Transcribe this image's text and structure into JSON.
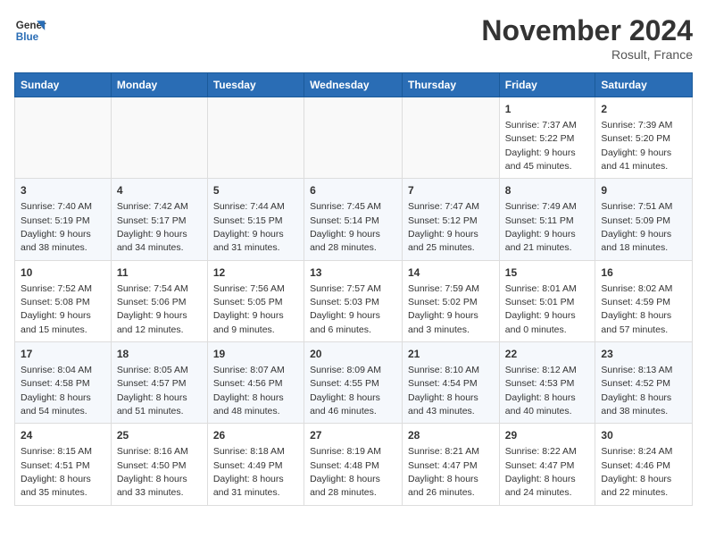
{
  "logo": {
    "line1": "General",
    "line2": "Blue"
  },
  "title": "November 2024",
  "location": "Rosult, France",
  "days_of_week": [
    "Sunday",
    "Monday",
    "Tuesday",
    "Wednesday",
    "Thursday",
    "Friday",
    "Saturday"
  ],
  "weeks": [
    [
      {
        "day": "",
        "detail": ""
      },
      {
        "day": "",
        "detail": ""
      },
      {
        "day": "",
        "detail": ""
      },
      {
        "day": "",
        "detail": ""
      },
      {
        "day": "",
        "detail": ""
      },
      {
        "day": "1",
        "detail": "Sunrise: 7:37 AM\nSunset: 5:22 PM\nDaylight: 9 hours and 45 minutes."
      },
      {
        "day": "2",
        "detail": "Sunrise: 7:39 AM\nSunset: 5:20 PM\nDaylight: 9 hours and 41 minutes."
      }
    ],
    [
      {
        "day": "3",
        "detail": "Sunrise: 7:40 AM\nSunset: 5:19 PM\nDaylight: 9 hours and 38 minutes."
      },
      {
        "day": "4",
        "detail": "Sunrise: 7:42 AM\nSunset: 5:17 PM\nDaylight: 9 hours and 34 minutes."
      },
      {
        "day": "5",
        "detail": "Sunrise: 7:44 AM\nSunset: 5:15 PM\nDaylight: 9 hours and 31 minutes."
      },
      {
        "day": "6",
        "detail": "Sunrise: 7:45 AM\nSunset: 5:14 PM\nDaylight: 9 hours and 28 minutes."
      },
      {
        "day": "7",
        "detail": "Sunrise: 7:47 AM\nSunset: 5:12 PM\nDaylight: 9 hours and 25 minutes."
      },
      {
        "day": "8",
        "detail": "Sunrise: 7:49 AM\nSunset: 5:11 PM\nDaylight: 9 hours and 21 minutes."
      },
      {
        "day": "9",
        "detail": "Sunrise: 7:51 AM\nSunset: 5:09 PM\nDaylight: 9 hours and 18 minutes."
      }
    ],
    [
      {
        "day": "10",
        "detail": "Sunrise: 7:52 AM\nSunset: 5:08 PM\nDaylight: 9 hours and 15 minutes."
      },
      {
        "day": "11",
        "detail": "Sunrise: 7:54 AM\nSunset: 5:06 PM\nDaylight: 9 hours and 12 minutes."
      },
      {
        "day": "12",
        "detail": "Sunrise: 7:56 AM\nSunset: 5:05 PM\nDaylight: 9 hours and 9 minutes."
      },
      {
        "day": "13",
        "detail": "Sunrise: 7:57 AM\nSunset: 5:03 PM\nDaylight: 9 hours and 6 minutes."
      },
      {
        "day": "14",
        "detail": "Sunrise: 7:59 AM\nSunset: 5:02 PM\nDaylight: 9 hours and 3 minutes."
      },
      {
        "day": "15",
        "detail": "Sunrise: 8:01 AM\nSunset: 5:01 PM\nDaylight: 9 hours and 0 minutes."
      },
      {
        "day": "16",
        "detail": "Sunrise: 8:02 AM\nSunset: 4:59 PM\nDaylight: 8 hours and 57 minutes."
      }
    ],
    [
      {
        "day": "17",
        "detail": "Sunrise: 8:04 AM\nSunset: 4:58 PM\nDaylight: 8 hours and 54 minutes."
      },
      {
        "day": "18",
        "detail": "Sunrise: 8:05 AM\nSunset: 4:57 PM\nDaylight: 8 hours and 51 minutes."
      },
      {
        "day": "19",
        "detail": "Sunrise: 8:07 AM\nSunset: 4:56 PM\nDaylight: 8 hours and 48 minutes."
      },
      {
        "day": "20",
        "detail": "Sunrise: 8:09 AM\nSunset: 4:55 PM\nDaylight: 8 hours and 46 minutes."
      },
      {
        "day": "21",
        "detail": "Sunrise: 8:10 AM\nSunset: 4:54 PM\nDaylight: 8 hours and 43 minutes."
      },
      {
        "day": "22",
        "detail": "Sunrise: 8:12 AM\nSunset: 4:53 PM\nDaylight: 8 hours and 40 minutes."
      },
      {
        "day": "23",
        "detail": "Sunrise: 8:13 AM\nSunset: 4:52 PM\nDaylight: 8 hours and 38 minutes."
      }
    ],
    [
      {
        "day": "24",
        "detail": "Sunrise: 8:15 AM\nSunset: 4:51 PM\nDaylight: 8 hours and 35 minutes."
      },
      {
        "day": "25",
        "detail": "Sunrise: 8:16 AM\nSunset: 4:50 PM\nDaylight: 8 hours and 33 minutes."
      },
      {
        "day": "26",
        "detail": "Sunrise: 8:18 AM\nSunset: 4:49 PM\nDaylight: 8 hours and 31 minutes."
      },
      {
        "day": "27",
        "detail": "Sunrise: 8:19 AM\nSunset: 4:48 PM\nDaylight: 8 hours and 28 minutes."
      },
      {
        "day": "28",
        "detail": "Sunrise: 8:21 AM\nSunset: 4:47 PM\nDaylight: 8 hours and 26 minutes."
      },
      {
        "day": "29",
        "detail": "Sunrise: 8:22 AM\nSunset: 4:47 PM\nDaylight: 8 hours and 24 minutes."
      },
      {
        "day": "30",
        "detail": "Sunrise: 8:24 AM\nSunset: 4:46 PM\nDaylight: 8 hours and 22 minutes."
      }
    ]
  ]
}
